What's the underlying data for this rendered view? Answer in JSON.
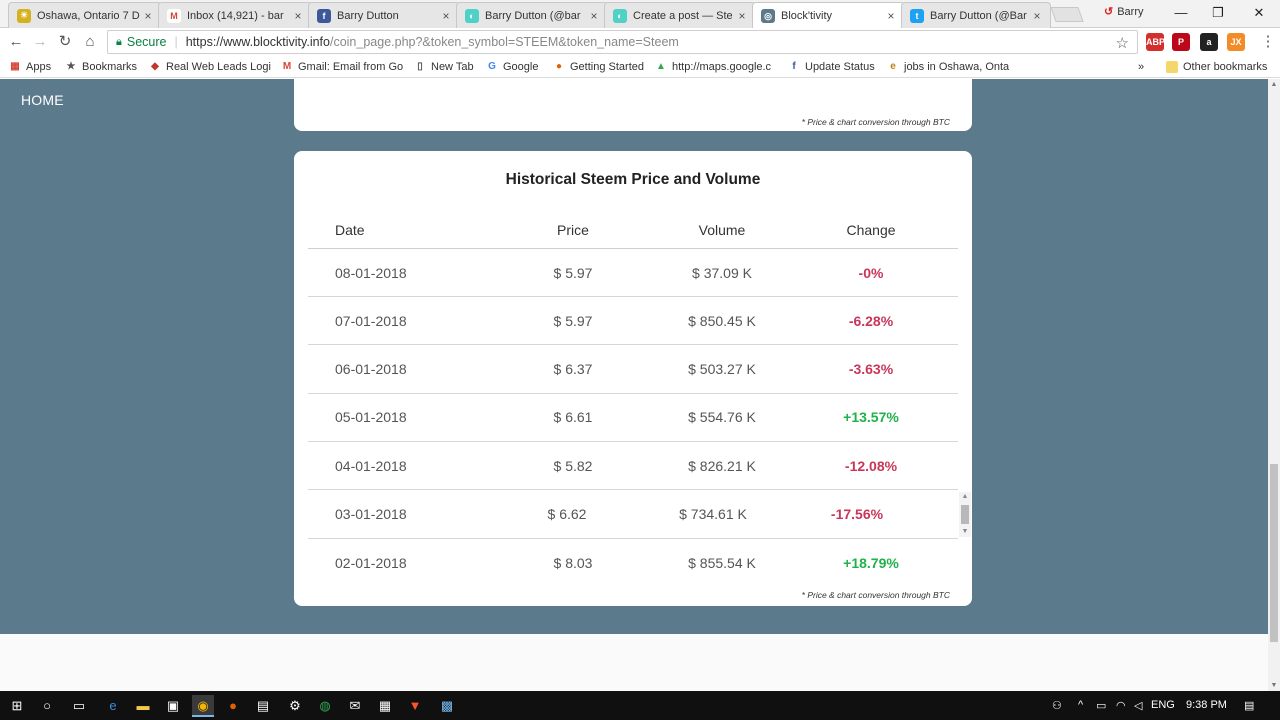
{
  "browser": {
    "tabs": [
      {
        "title": "Oshawa, Ontario 7 D",
        "fav_color": "#d4b21f",
        "fav_glyph": "☀"
      },
      {
        "title": "Inbox (14,921) - bar",
        "fav_color": "#ffffff",
        "fav_glyph": "M"
      },
      {
        "title": "Barry Dutton",
        "fav_color": "#3b5998",
        "fav_glyph": "f"
      },
      {
        "title": "Barry Dutton (@bar",
        "fav_color": "#4fd1c5",
        "fav_glyph": "◐"
      },
      {
        "title": "Create a post — Ste",
        "fav_color": "#4fd1c5",
        "fav_glyph": "◐"
      },
      {
        "title": "Block'tivity",
        "fav_color": "#5b7a8c",
        "fav_glyph": "◎"
      },
      {
        "title": "Barry Dutton (@Bar",
        "fav_color": "#1da1f2",
        "fav_glyph": "t"
      }
    ],
    "close_glyph": "×",
    "profile_name": "Barry",
    "window_controls": {
      "minimize": "—",
      "restore": "❐",
      "close": "✕"
    },
    "nav": {
      "back": "←",
      "forward": "→",
      "reload": "↻",
      "home": "⌂"
    },
    "omnibox": {
      "secure_label": "Secure",
      "url_host": "https://www.blocktivity.info",
      "url_path": "/coin_page.php?&token_symbol=STEEM&token_name=Steem",
      "star": "☆"
    },
    "extensions": [
      {
        "label": "ABP",
        "color": "#d32f2f"
      },
      {
        "label": "P",
        "color": "#bd081c"
      },
      {
        "label": "a",
        "color": "#222222"
      },
      {
        "label": "JX",
        "color": "#f28c28"
      }
    ],
    "menu_glyph": "⋮",
    "bookmarks": [
      {
        "label": "Apps",
        "icon": "apps-grid-icon",
        "glyph": "▦",
        "color": "#d44638"
      },
      {
        "label": "Bookmarks",
        "icon": "star-icon",
        "glyph": "★",
        "color": "#555555"
      },
      {
        "label": "Real Web Leads Logi",
        "icon": "leads-icon",
        "glyph": "◆",
        "color": "#c0392b"
      },
      {
        "label": "Gmail: Email from Go",
        "icon": "gmail-icon",
        "glyph": "M",
        "color": "#d44638"
      },
      {
        "label": "New Tab",
        "icon": "page-icon",
        "glyph": "▯",
        "color": "#555555"
      },
      {
        "label": "Google",
        "icon": "google-icon",
        "glyph": "G",
        "color": "#4285f4"
      },
      {
        "label": "Getting Started",
        "icon": "firefox-icon",
        "glyph": "●",
        "color": "#e66000"
      },
      {
        "label": "http://maps.google.c",
        "icon": "maps-icon",
        "glyph": "▲",
        "color": "#34a853"
      },
      {
        "label": "Update Status",
        "icon": "facebook-icon",
        "glyph": "f",
        "color": "#3b5998"
      },
      {
        "label": "jobs in Oshawa, Onta",
        "icon": "jobs-icon",
        "glyph": "e",
        "color": "#b8860b"
      }
    ],
    "bookmarks_overflow": "»",
    "other_bookmarks": "Other bookmarks"
  },
  "page": {
    "nav_home": "HOME",
    "top_card_note": "* Price & chart conversion through BTC",
    "table": {
      "title": "Historical Steem Price and Volume",
      "headers": {
        "date": "Date",
        "price": "Price",
        "volume": "Volume",
        "change": "Change"
      },
      "rows": [
        {
          "date": "08-01-2018",
          "price": "$ 5.97",
          "volume": "$ 37.09 K",
          "change": "-0%",
          "direction": "neg"
        },
        {
          "date": "07-01-2018",
          "price": "$ 5.97",
          "volume": "$ 850.45 K",
          "change": "-6.28%",
          "direction": "neg"
        },
        {
          "date": "06-01-2018",
          "price": "$ 6.37",
          "volume": "$ 503.27 K",
          "change": "-3.63%",
          "direction": "neg"
        },
        {
          "date": "05-01-2018",
          "price": "$ 6.61",
          "volume": "$ 554.76 K",
          "change": "+13.57%",
          "direction": "pos"
        },
        {
          "date": "04-01-2018",
          "price": "$ 5.82",
          "volume": "$ 826.21 K",
          "change": "-12.08%",
          "direction": "neg"
        },
        {
          "date": "03-01-2018",
          "price": "$ 6.62",
          "volume": "$ 734.61 K",
          "change": "-17.56%",
          "direction": "neg"
        },
        {
          "date": "02-01-2018",
          "price": "$ 8.03",
          "volume": "$ 855.54 K",
          "change": "+18.79%",
          "direction": "pos"
        }
      ],
      "note": "* Price & chart conversion through BTC"
    }
  },
  "taskbar": {
    "language": "ENG",
    "time": "9:38 PM"
  }
}
